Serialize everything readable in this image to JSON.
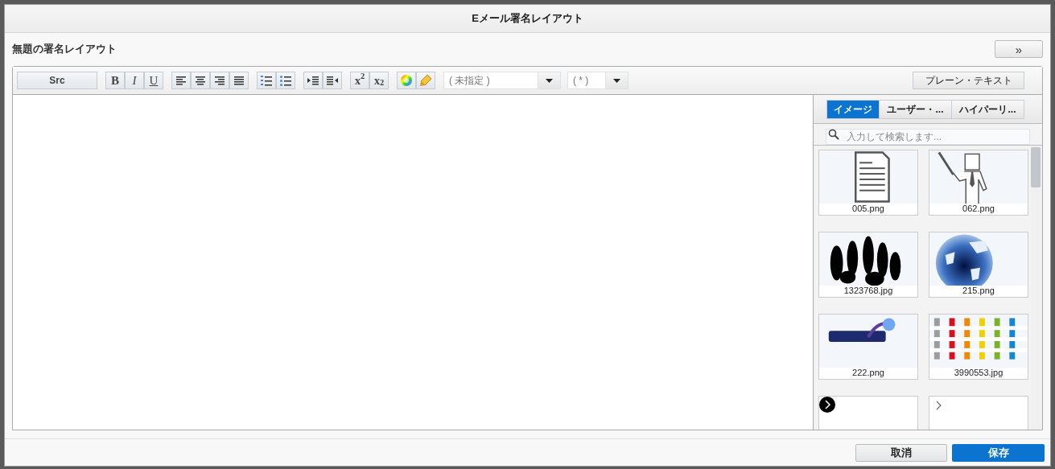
{
  "dialog": {
    "title": "Eメール署名レイアウト",
    "subtitle": "無題の署名レイアウト",
    "expand_button": "»"
  },
  "toolbar": {
    "groups": [
      [
        {
          "kind": "src",
          "label": "Src"
        }
      ],
      [
        {
          "kind": "bold",
          "label": "B"
        },
        {
          "kind": "italic",
          "label": "I"
        },
        {
          "kind": "underline",
          "label": "U"
        }
      ],
      [
        {
          "kind": "align-left"
        },
        {
          "kind": "align-center"
        },
        {
          "kind": "align-right"
        },
        {
          "kind": "justify"
        }
      ],
      [
        {
          "kind": "ordered-list"
        },
        {
          "kind": "bullet-list"
        }
      ],
      [
        {
          "kind": "indent"
        },
        {
          "kind": "outdent"
        }
      ],
      [
        {
          "kind": "superscript",
          "label": "x$^{2}$"
        },
        {
          "kind": "subscript",
          "label": "x$_{2}$"
        }
      ],
      [
        {
          "kind": "text-color"
        },
        {
          "kind": "highlight"
        }
      ]
    ],
    "font_select": {
      "value": "( 未指定 )"
    },
    "size_select": {
      "value": "( * )"
    },
    "plain_text_button": "プレーン・テキスト"
  },
  "side_panel": {
    "tabs": [
      {
        "label": "イメージ",
        "selected": true
      },
      {
        "label": "ユーザー・...",
        "selected": false
      },
      {
        "label": "ハイパーリ...",
        "selected": false
      }
    ],
    "search": {
      "placeholder": "入力して検索します..."
    },
    "items": [
      {
        "kind": "picture",
        "filename": "005.png"
      },
      {
        "kind": "picture",
        "filename": "062.png"
      },
      {
        "kind": "picture",
        "filename": "1323768.jpg"
      },
      {
        "kind": "picture",
        "filename": "215.png"
      },
      {
        "kind": "picture",
        "filename": "222.png"
      },
      {
        "kind": "picture",
        "filename": "3990553.jpg"
      },
      {
        "kind": "dark-arrow"
      },
      {
        "kind": "light-arrow"
      }
    ]
  },
  "footer": {
    "cancel_button": "取消",
    "save_button": "保存"
  }
}
